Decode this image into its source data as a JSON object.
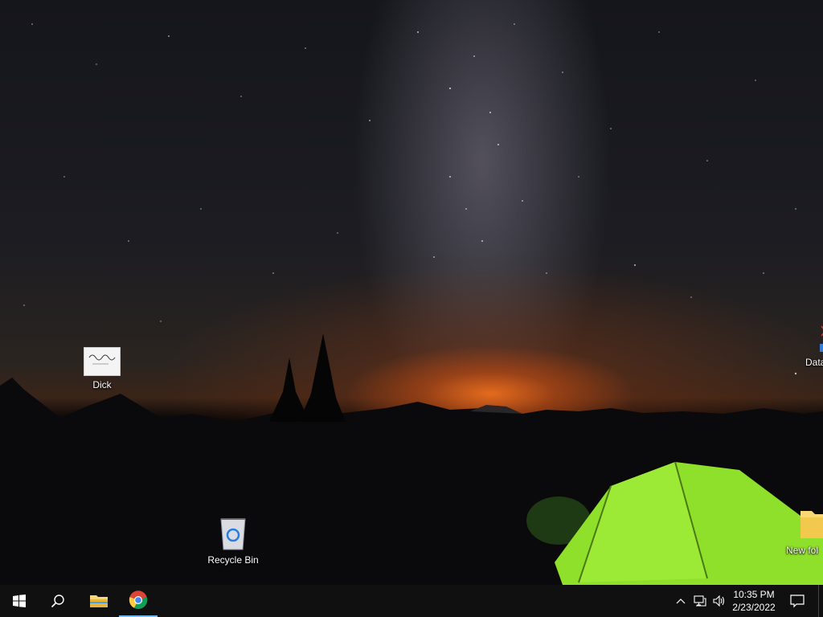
{
  "desktop": {
    "icons": [
      {
        "label": "Dick",
        "icon": "image-file-icon"
      },
      {
        "label": "Recycle Bin",
        "icon": "recycle-bin-icon"
      },
      {
        "label": "Data",
        "icon": "shortcut-icon"
      },
      {
        "label": "New fol",
        "icon": "folder-icon"
      }
    ]
  },
  "taskbar": {
    "start": "windows-start-icon",
    "search": "search-icon",
    "pinned": [
      {
        "name": "File Explorer",
        "icon": "folder-icon"
      },
      {
        "name": "Google Chrome",
        "icon": "chrome-icon",
        "active": true
      }
    ],
    "tray": {
      "icons": [
        "chevron-up-icon",
        "network-icon",
        "volume-icon"
      ],
      "time": "10:35 PM",
      "date": "2/23/2022"
    },
    "notification": "action-center-icon"
  },
  "colors": {
    "taskbar_bg": "#101010",
    "active_indicator": "#76b9ed",
    "tent_green": "#8ee02a"
  }
}
